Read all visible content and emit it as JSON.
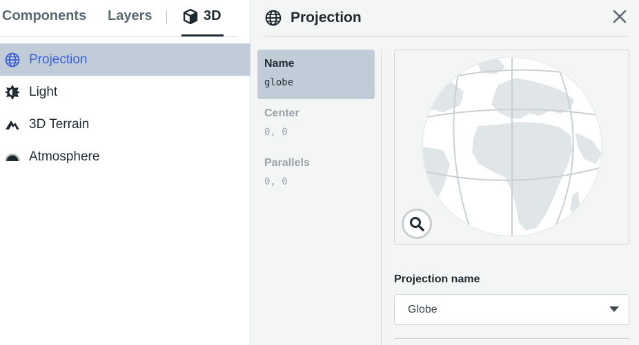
{
  "tabs": {
    "components": "Components",
    "layers": "Layers",
    "three_d": "3D"
  },
  "nav": [
    {
      "label": "Projection",
      "icon": "globe-icon",
      "active": true
    },
    {
      "label": "Light",
      "icon": "sun-icon",
      "active": false
    },
    {
      "label": "3D Terrain",
      "icon": "mountain-icon",
      "active": false
    },
    {
      "label": "Atmosphere",
      "icon": "atmosphere-icon",
      "active": false
    }
  ],
  "panel": {
    "title": "Projection",
    "properties": [
      {
        "label": "Name",
        "value": "globe"
      },
      {
        "label": "Center",
        "value": "0, 0"
      },
      {
        "label": "Parallels",
        "value": "0, 0"
      }
    ],
    "field_label": "Projection name",
    "select_value": "Globe"
  },
  "colors": {
    "accent": "#3b5fd9",
    "active_bg": "#c0ccd8"
  }
}
